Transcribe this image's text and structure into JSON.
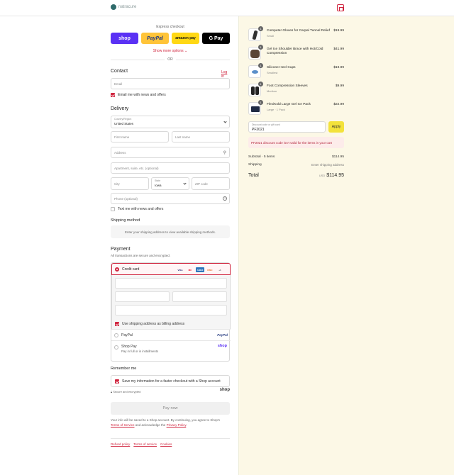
{
  "header": {
    "logo_text": "natracure"
  },
  "express": {
    "label": "Express checkout",
    "shop": "shop",
    "paypal": "PayPal",
    "amazon": "amazon pay",
    "gpay": "G Pay",
    "show_more": "Show more options",
    "or": "OR"
  },
  "contact": {
    "title": "Contact",
    "login": "Log in",
    "email_placeholder": "Email",
    "news_label": "Email me with news and offers"
  },
  "delivery": {
    "title": "Delivery",
    "country_label": "Country/Region",
    "country_value": "United States",
    "first_name": "First name",
    "last_name": "Last name",
    "address": "Address",
    "apartment": "Apartment, suite, etc. (optional)",
    "city": "City",
    "state_label": "State",
    "state_value": "Iowa",
    "zip": "ZIP code",
    "phone": "Phone (optional)",
    "text_label": "Text me with news and offers"
  },
  "shipping": {
    "title": "Shipping method",
    "notice": "Enter your shipping address to view available shipping methods."
  },
  "payment": {
    "title": "Payment",
    "subtitle": "All transactions are secure and encrypted.",
    "credit_card": "Credit card",
    "cards": [
      "VISA",
      "MC",
      "AMEX",
      "DISC",
      "+1"
    ],
    "billing_label": "Use shipping address as billing address",
    "paypal": "PayPal",
    "paypal_logo": "PayPal",
    "shop_pay": "Shop Pay",
    "shop_pay_sub": "Pay in full or in installments",
    "shop_logo": "shop"
  },
  "remember": {
    "title": "Remember me",
    "save_label": "Save my information for a faster checkout with a Shop account",
    "secure": "Secure and encrypted",
    "shop_logo": "shop"
  },
  "pay_now": "Pay now",
  "legal": {
    "line1": "Your info will be saved to a Shop account. By continuing, you agree to Shop's",
    "terms": "Terms of Service",
    "and": "and acknowledge the",
    "privacy": "Privacy Policy",
    "end": "."
  },
  "footer": {
    "links": [
      "Refund policy",
      "Terms of service",
      "Cookies"
    ]
  },
  "cart": {
    "items": [
      {
        "qty": "1",
        "name": "Computer Gloves for Carpal Tunnel Relief",
        "variant": "Small",
        "price": "$19.99"
      },
      {
        "qty": "1",
        "name": "Gel Ice Shoulder Brace with Hot/Cold Compression",
        "variant": "",
        "price": "$41.99"
      },
      {
        "qty": "1",
        "name": "Silicone Heel Cups",
        "variant": "Smallest",
        "price": "$19.99"
      },
      {
        "qty": "1",
        "name": "Foot Compression Sleeves",
        "variant": "Medium",
        "price": "$9.99"
      },
      {
        "qty": "1",
        "name": "FlexiKold Large Gel Ice Pack",
        "variant": "Large · 1 Pack",
        "price": "$22.99"
      }
    ],
    "discount_label": "Discount code or gift card",
    "discount_value": "PF2021",
    "apply": "Apply",
    "error": "PF2021 discount code isn't valid for the items in your cart",
    "subtotal_label": "Subtotal · 5 items",
    "subtotal": "$114.95",
    "shipping_label": "Shipping",
    "shipping_value": "Enter shipping address",
    "total_label": "Total",
    "currency": "USD",
    "total": "$114.95",
    "colors": {
      "accent": "#d0253f",
      "panel": "#fcf8e6",
      "apply": "#f3e23b"
    }
  }
}
